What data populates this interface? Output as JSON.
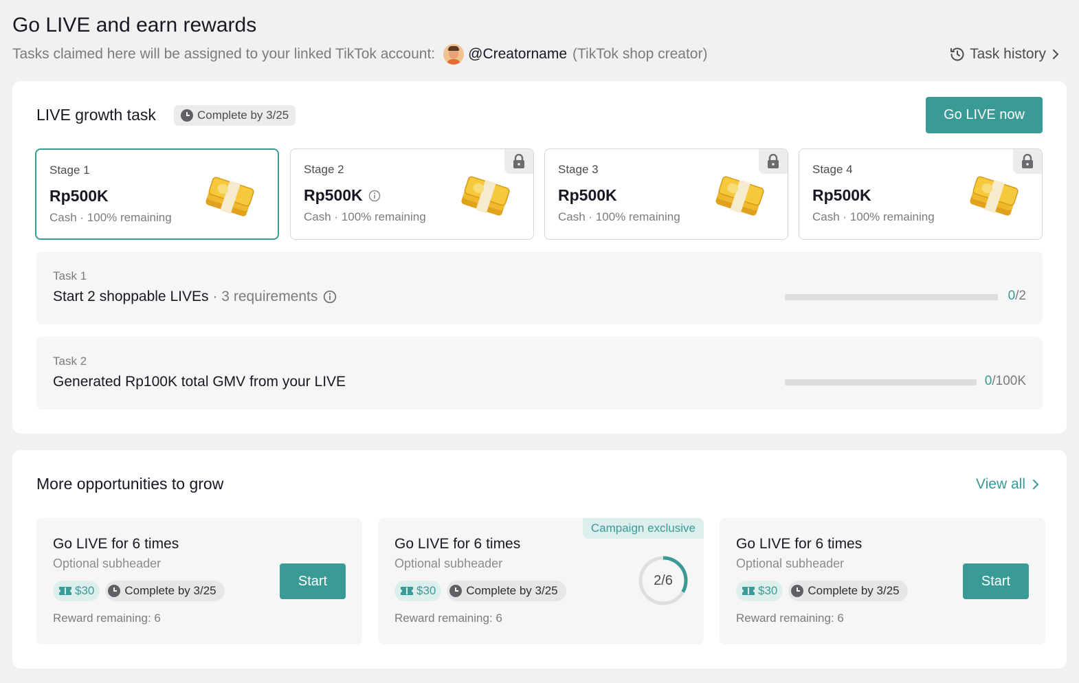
{
  "header": {
    "title": "Go LIVE and earn rewards",
    "subtitle": "Tasks claimed here will be assigned to your linked TikTok account:",
    "creator_name": "@Creatorname",
    "creator_role": "(TikTok shop creator)",
    "task_history_label": "Task history"
  },
  "growth": {
    "title": "LIVE growth task",
    "deadline": "Complete by 3/25",
    "go_live_label": "Go LIVE now",
    "stages": [
      {
        "label": "Stage 1",
        "amount": "Rp500K",
        "sub": "Cash · 100% remaining",
        "locked": false,
        "active": true
      },
      {
        "label": "Stage 2",
        "amount": "Rp500K",
        "sub": "Cash · 100% remaining",
        "locked": true,
        "active": false
      },
      {
        "label": "Stage 3",
        "amount": "Rp500K",
        "sub": "Cash · 100% remaining",
        "locked": true,
        "active": false
      },
      {
        "label": "Stage 4",
        "amount": "Rp500K",
        "sub": "Cash · 100% remaining",
        "locked": true,
        "active": false
      }
    ],
    "tasks": [
      {
        "label": "Task 1",
        "title": "Start 2 shoppable LIVEs",
        "requirements": "· 3 requirements",
        "current": "0",
        "total": "/2",
        "progress": 0
      },
      {
        "label": "Task 2",
        "title": "Generated Rp100K total GMV from your LIVE",
        "current": "0",
        "total": "/100K",
        "progress": 0
      }
    ]
  },
  "opportunities": {
    "title": "More opportunities to grow",
    "view_all_label": "View all",
    "items": [
      {
        "title": "Go LIVE for 6 times",
        "subheader": "Optional subheader",
        "reward": "$30",
        "deadline": "Complete by 3/25",
        "remaining": "Reward remaining: 6",
        "button_label": "Start"
      },
      {
        "title": "Go LIVE for 6 times",
        "subheader": "Optional subheader",
        "reward": "$30",
        "deadline": "Complete by 3/25",
        "remaining": "Reward remaining: 6",
        "badge": "Campaign exclusive",
        "progress_text": "2/6",
        "progress": 0.333
      },
      {
        "title": "Go LIVE for 6 times",
        "subheader": "Optional subheader",
        "reward": "$30",
        "deadline": "Complete by 3/25",
        "remaining": "Reward remaining: 6",
        "button_label": "Start"
      }
    ]
  },
  "colors": {
    "accent": "#3a9a96",
    "accent_light": "#dcefed",
    "background": "#f1f1f1"
  },
  "icons": [
    "history-icon",
    "chevron-right-icon",
    "clock-icon",
    "lock-icon",
    "info-icon",
    "money-stack-icon",
    "ticket-icon",
    "avatar"
  ]
}
